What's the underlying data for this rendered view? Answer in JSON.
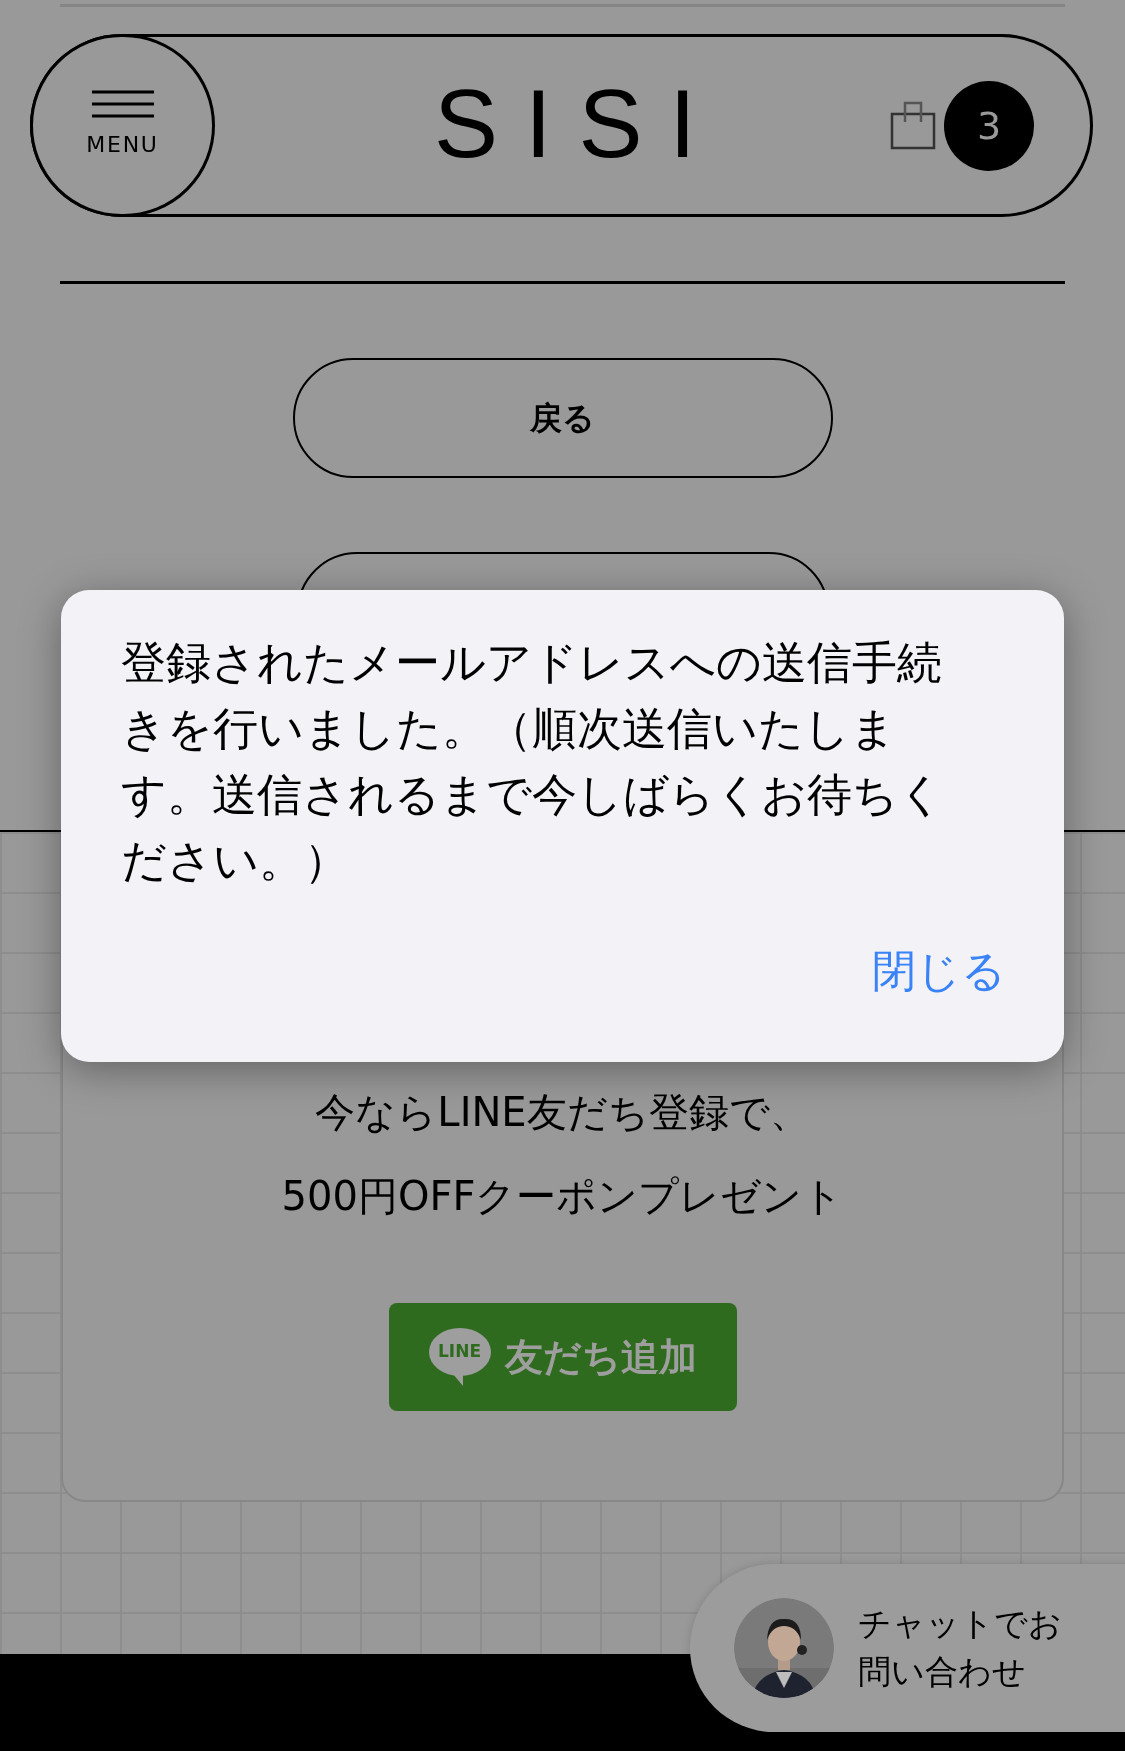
{
  "header": {
    "menu_label": "MENU",
    "logo": "SISI",
    "cart_count": "3"
  },
  "back_button": "戻る",
  "dialog": {
    "message": "登録されたメールアドレスへの送信手続きを行いました。（順次送信いたします。送信されるまで今しばらくお待ちください。）",
    "close_button": "閉じる"
  },
  "line_promo": {
    "lines": [
      "今ならLINE友だち登録で、",
      "500円OFFクーポンプレゼント"
    ],
    "button": {
      "logo": "LINE",
      "label": "友だち追加"
    }
  },
  "chat_button": {
    "label": "チャットでお問い合わせ"
  }
}
